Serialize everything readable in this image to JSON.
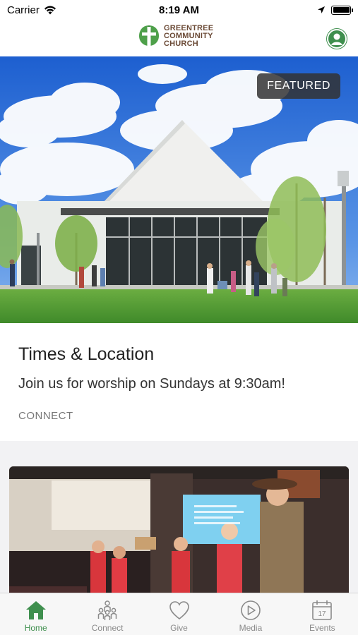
{
  "status_bar": {
    "carrier": "Carrier",
    "time": "8:19 AM"
  },
  "header": {
    "logo_lines": [
      "GREENTREE",
      "COMMUNITY",
      "CHURCH"
    ],
    "brand_color": "#3f8f4e"
  },
  "feed": {
    "featured": {
      "badge": "FEATURED",
      "title": "Times & Location",
      "subtitle": "Join us for worship on Sundays at 9:30am!",
      "category": "CONNECT"
    }
  },
  "tabs": [
    {
      "label": "Home",
      "icon": "home-icon",
      "active": true
    },
    {
      "label": "Connect",
      "icon": "people-icon",
      "active": false
    },
    {
      "label": "Give",
      "icon": "heart-icon",
      "active": false
    },
    {
      "label": "Media",
      "icon": "play-icon",
      "active": false
    },
    {
      "label": "Events",
      "icon": "calendar-icon",
      "active": false
    }
  ],
  "colors": {
    "accent": "#3f8f4e",
    "inactive": "#8a8a8a"
  }
}
